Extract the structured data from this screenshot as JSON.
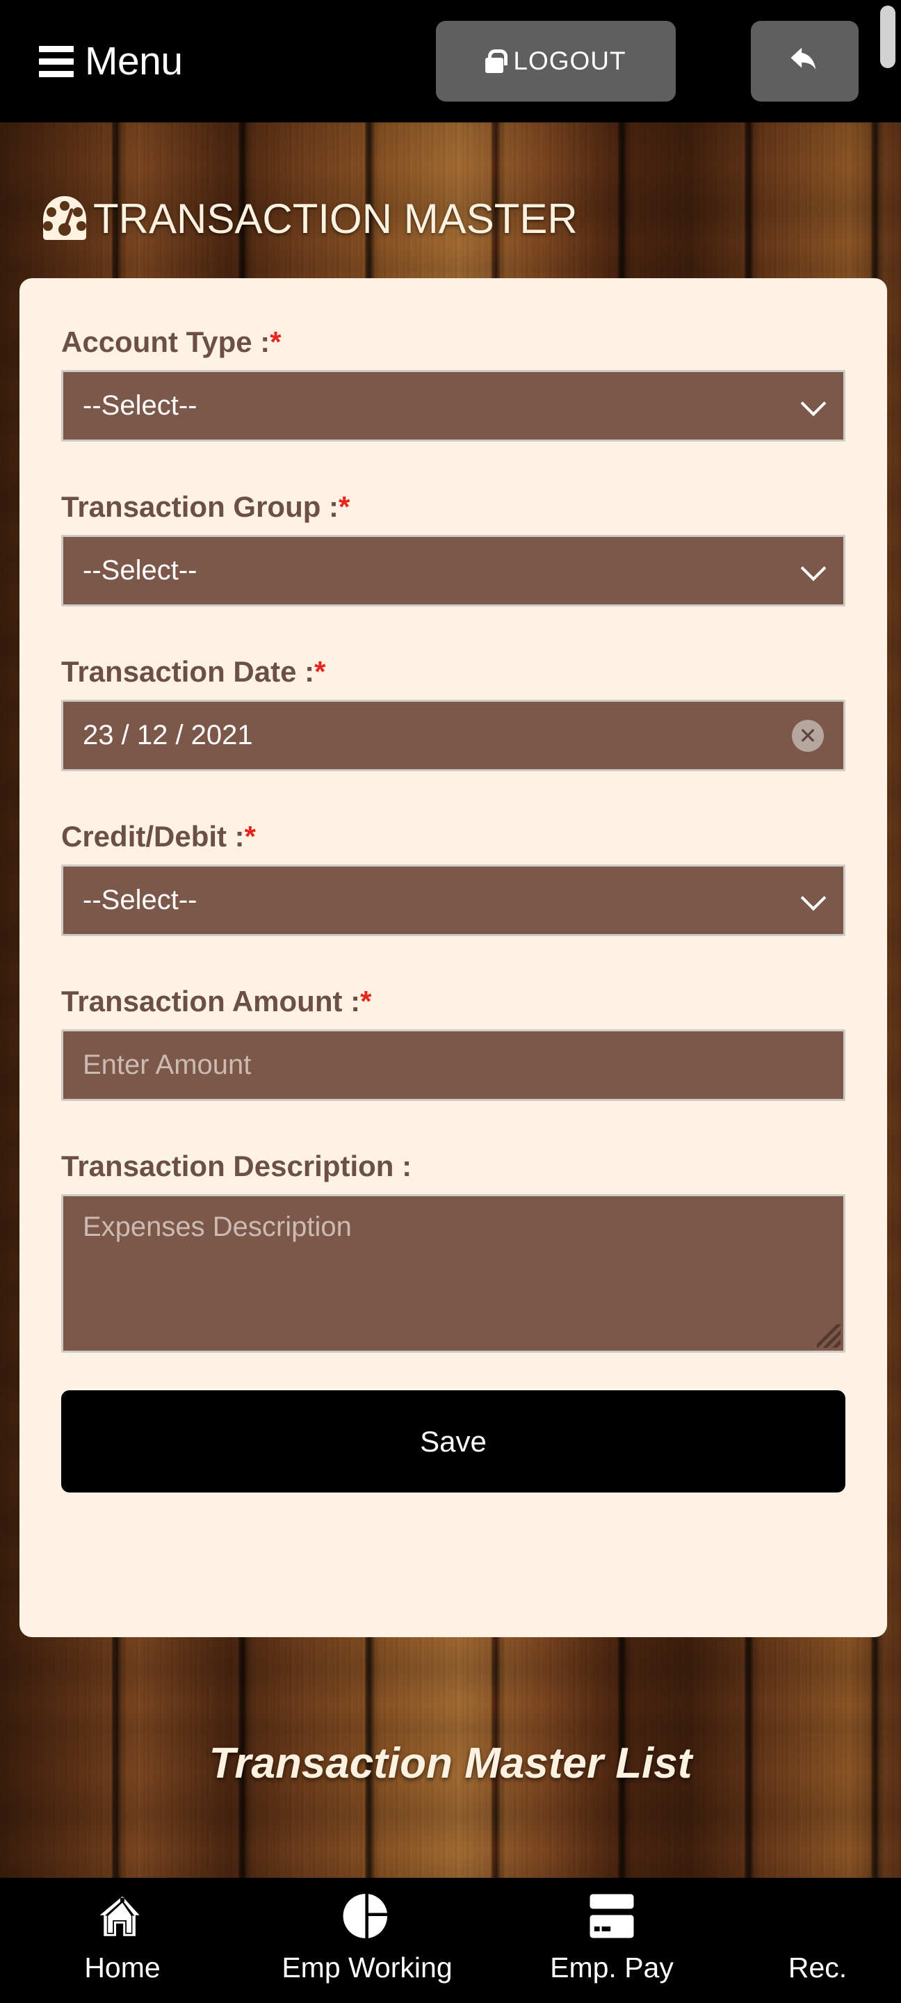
{
  "topbar": {
    "menu_label": "Menu",
    "menu_icon": "hamburger-icon",
    "logout_label": "LOGOUT",
    "logout_icon": "lock-icon",
    "back_icon": "reply-arrow-icon"
  },
  "header": {
    "title": "TRANSACTION MASTER",
    "icon": "tachometer-icon"
  },
  "form": {
    "fields": [
      {
        "label": "Account Type :",
        "required": "*",
        "type": "select",
        "value": "--Select--"
      },
      {
        "label": "Transaction Group :",
        "required": "*",
        "type": "select",
        "value": "--Select--"
      },
      {
        "label": "Transaction Date :",
        "required": "*",
        "type": "date",
        "value": "23 / 12 / 2021",
        "clear_icon": "clear-circle-icon"
      },
      {
        "label": "Credit/Debit :",
        "required": "*",
        "type": "select",
        "value": "--Select--"
      },
      {
        "label": "Transaction Amount :",
        "required": "*",
        "type": "text",
        "placeholder": "Enter Amount"
      },
      {
        "label": "Transaction Description :",
        "required": "",
        "type": "textarea",
        "placeholder": "Expenses Description"
      }
    ],
    "save_label": "Save"
  },
  "list_section": {
    "heading": "Transaction Master List"
  },
  "bottom_nav": {
    "items": [
      {
        "label": "Home",
        "icon": "home-icon"
      },
      {
        "label": "Emp Working",
        "icon": "pie-chart-icon"
      },
      {
        "label": "Emp. Pay",
        "icon": "credit-card-icon"
      },
      {
        "label": "Rec.",
        "icon": ""
      }
    ]
  },
  "colors": {
    "card_bg": "#fdf2e4",
    "field_bg": "#7b5849",
    "label_text": "#6c5047",
    "required_asterisk": "#e8241c",
    "save_button": "#000000",
    "topbar_bg": "#000000",
    "button_grey": "#5f5f5f",
    "title_cream": "#fdf2e0",
    "wood_brown": "#5a3318"
  }
}
